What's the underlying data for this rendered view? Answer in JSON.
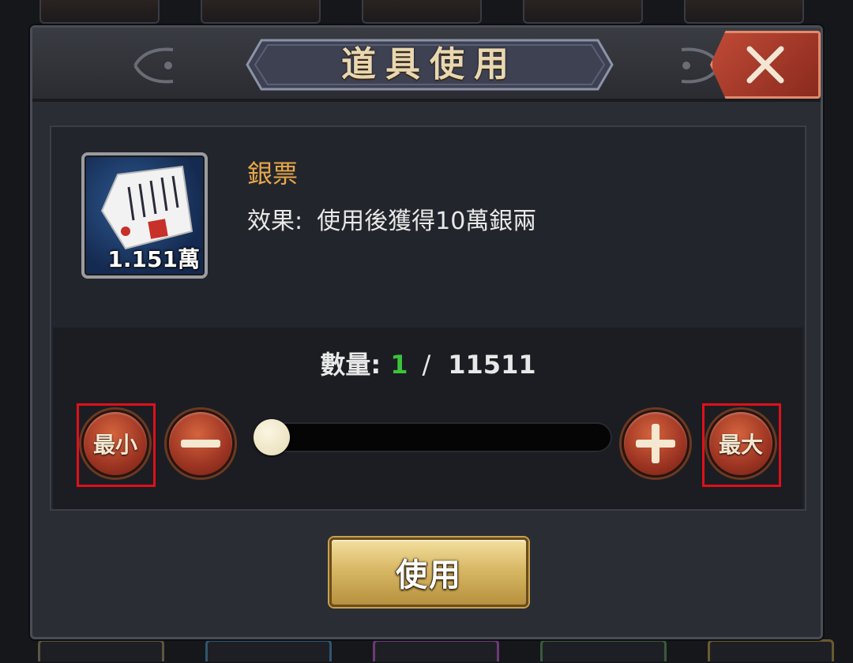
{
  "dialog": {
    "title": "道具使用",
    "close_icon": "close-x-icon"
  },
  "item": {
    "name": "銀票",
    "effect_label": "效果:",
    "effect_text": "使用後獲得10萬銀兩",
    "count": "1.151萬",
    "icon": "silver-note-icon"
  },
  "quantity": {
    "label": "數量:",
    "current": "1",
    "separator": "/",
    "max": "11511",
    "slider_fraction": 0
  },
  "buttons": {
    "min": "最小",
    "max": "最大",
    "minus_icon": "minus-icon",
    "plus_icon": "plus-icon",
    "use": "使用"
  },
  "colors": {
    "item_name": "#e6a64a",
    "current_qty": "#3cc23c",
    "highlight": "#e0101a"
  }
}
